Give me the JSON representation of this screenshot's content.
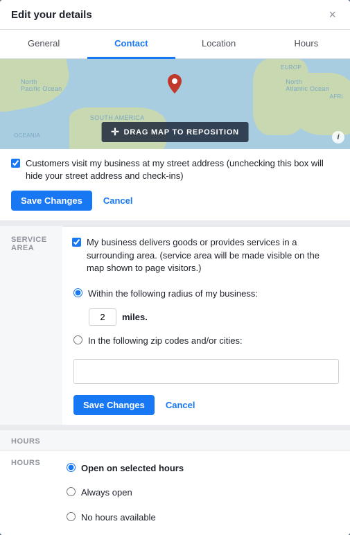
{
  "modal": {
    "title": "Edit your details",
    "close_label": "×"
  },
  "tabs": [
    {
      "id": "general",
      "label": "General",
      "active": false
    },
    {
      "id": "contact",
      "label": "Contact",
      "active": true
    },
    {
      "id": "location",
      "label": "Location",
      "active": false
    },
    {
      "id": "hours",
      "label": "Hours",
      "active": false
    }
  ],
  "map": {
    "drag_label": "DRAG MAP TO REPOSITION",
    "drag_icon": "✛",
    "info_icon": "i"
  },
  "street_address": {
    "checkbox_label": "Customers visit my business at my street address (unchecking this box will hide your street address and check-ins)",
    "checked": true,
    "save_label": "Save Changes",
    "cancel_label": "Cancel"
  },
  "service_area": {
    "section_label": "Service Area",
    "checkbox_label": "My business delivers goods or provides services in a surrounding area. (service area will be made visible on the map shown to page visitors.)",
    "checked": true,
    "radius_radio_label": "Within the following radius of my business:",
    "radius_value": "2",
    "radius_unit": "miles.",
    "zip_radio_label": "In the following zip codes and/or cities:",
    "zip_placeholder": "",
    "save_label": "Save Changes",
    "cancel_label": "Cancel"
  },
  "hours": {
    "section_label": "HOURS",
    "field_label": "Hours",
    "options": [
      {
        "label": "Open on selected hours",
        "selected": true
      },
      {
        "label": "Always open",
        "selected": false
      },
      {
        "label": "No hours available",
        "selected": false
      }
    ]
  }
}
